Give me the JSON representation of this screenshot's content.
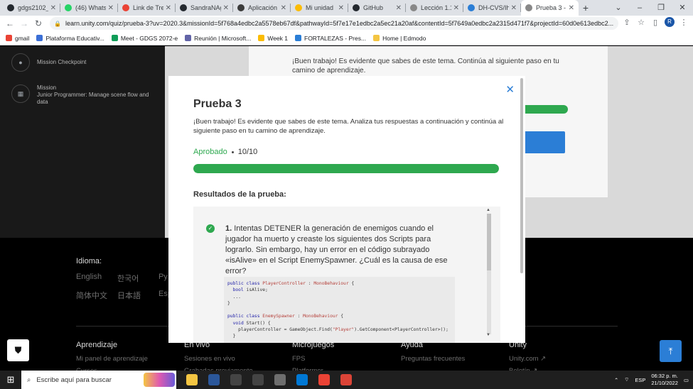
{
  "browser": {
    "tabs": [
      {
        "title": "gdgs2102_",
        "color": "#24292f"
      },
      {
        "title": "(46) Whats",
        "color": "#25d366"
      },
      {
        "title": "Link de Tre",
        "color": "#ea4335"
      },
      {
        "title": "SandraNAg",
        "color": "#24292f"
      },
      {
        "title": "Aplicación",
        "color": "#3b3b3b"
      },
      {
        "title": "Mi unidad",
        "color": "#fbbc04"
      },
      {
        "title": "GitHub",
        "color": "#24292f"
      },
      {
        "title": "Lección 1.1",
        "color": "#888888"
      },
      {
        "title": "DH-CVS/Ih",
        "color": "#2b7ed6"
      },
      {
        "title": "Prueba 3 -",
        "color": "#888888",
        "active": true
      }
    ],
    "url": "learn.unity.com/quiz/prueba-3?uv=2020.3&missionId=5f768a4edbc2a5578eb67df&pathwayId=5f7e17e1edbc2a5ec21a20af&contentId=5f7649a0edbc2a2315d471f7&projectId=60d0e613edbc2...",
    "avatar_letter": "R",
    "bookmarks": [
      {
        "label": "gmail",
        "color": "#ea4335"
      },
      {
        "label": "Plataforma Educativ...",
        "color": "#3b6fd6"
      },
      {
        "label": "Meet - GDGS 2072-e",
        "color": "#0f9d58"
      },
      {
        "label": "Reunión | Microsoft...",
        "color": "#6264a7"
      },
      {
        "label": "Week 1",
        "color": "#fbbc04"
      },
      {
        "label": "FORTALEZAS - Pres...",
        "color": "#2b7ed6"
      },
      {
        "label": "Home | Edmodo",
        "color": "#f4c542"
      }
    ]
  },
  "sidebar": {
    "items": [
      {
        "label": "Mission Checkpoint"
      },
      {
        "label": "Mission",
        "sub": "Junior Programmer: Manage scene flow and data"
      }
    ]
  },
  "background": {
    "text": "¡Buen trabajo! Es evidente que sabes de este tema. Continúa al siguiente paso en tu camino de aprendizaje."
  },
  "modal": {
    "title": "Prueba 3",
    "intro": "¡Buen trabajo! Es evidente que sabes de este tema. Analiza tus respuestas a continuación y continúa al siguiente paso en tu camino de aprendizaje.",
    "status": "Aprobado",
    "score": "10/10",
    "progress": 1.0,
    "results_heading": "Resultados de la prueba:",
    "question": {
      "number": "1.",
      "text": "Intentas DETENER la generación de enemigos cuando el jugador ha muerto y creaste los siguientes dos Scripts para lograrlo. Sin embargo, hay un error en el código subrayado «isAlive» en el Script EnemySpawner. ¿Cuál es la causa de ese error?"
    }
  },
  "footer": {
    "language_title": "Idioma:",
    "languages": [
      "English",
      "한국어",
      "Py",
      "简体中文",
      "日本語",
      "Esp"
    ],
    "columns": [
      {
        "heading": "Aprendizaje",
        "links": [
          "Mi panel de aprendizaje",
          "Cursos"
        ]
      },
      {
        "heading": "En vivo",
        "links": [
          "Sesiones en vivo",
          "Grabadas previamente"
        ]
      },
      {
        "heading": "Microjuegos",
        "links": [
          "FPS",
          "Platformer"
        ]
      },
      {
        "heading": "Ayuda",
        "links": [
          "Preguntas frecuentes"
        ]
      },
      {
        "heading": "Unity",
        "links": [
          "Unity.com ↗",
          "Boletín ↗"
        ]
      }
    ]
  },
  "taskbar": {
    "search_placeholder": "Escribe aquí para buscar",
    "icons": [
      {
        "name": "file-explorer-icon",
        "color": "#f4c542"
      },
      {
        "name": "word-icon",
        "color": "#2b579a"
      },
      {
        "name": "unity-hub-icon",
        "color": "#444444"
      },
      {
        "name": "unity-icon",
        "color": "#444444"
      },
      {
        "name": "settings-icon",
        "color": "#6e6e6e"
      },
      {
        "name": "vscode-icon",
        "color": "#0078d4"
      },
      {
        "name": "chrome-icon",
        "color": "#ea4335"
      },
      {
        "name": "chrome-active-icon",
        "color": "#db4437"
      }
    ],
    "lang": "ESP",
    "time": "06:32 p. m.",
    "date": "21/10/2022"
  }
}
